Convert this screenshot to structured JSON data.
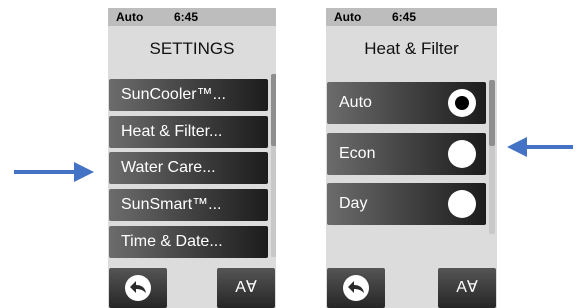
{
  "left_screen": {
    "status": {
      "mode": "Auto",
      "time": "6:45"
    },
    "title": "SETTINGS",
    "menu_items": [
      {
        "label": "SunCooler™..."
      },
      {
        "label": "Heat & Filter..."
      },
      {
        "label": "Water Care..."
      },
      {
        "label": "SunSmart™..."
      },
      {
        "label": "Time & Date..."
      }
    ],
    "buttons": {
      "back_icon": "back-arrow-icon",
      "updown_label": "A∀"
    }
  },
  "right_screen": {
    "status": {
      "mode": "Auto",
      "time": "6:45"
    },
    "title": "Heat & Filter",
    "options": [
      {
        "label": "Auto",
        "selected": true
      },
      {
        "label": "Econ",
        "selected": false
      },
      {
        "label": "Day",
        "selected": false
      }
    ],
    "buttons": {
      "back_icon": "back-arrow-icon",
      "updown_label": "A∀"
    }
  },
  "annotations": {
    "arrow_color": "#4472c4"
  }
}
